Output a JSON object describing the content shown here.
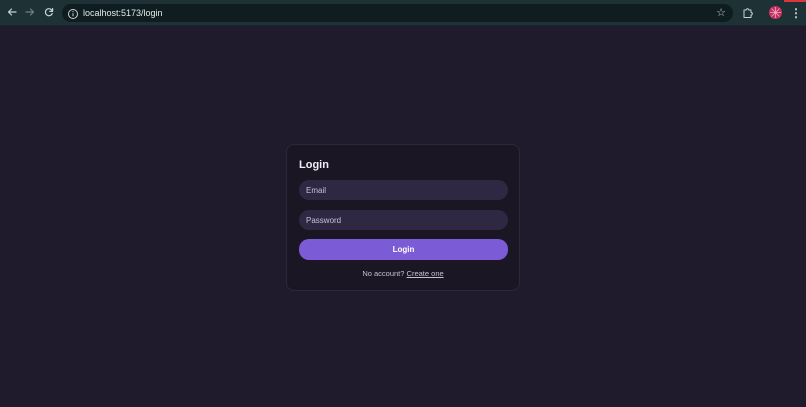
{
  "browser": {
    "url": "localhost:5173/login",
    "back_icon": "arrow-left-icon",
    "forward_icon": "arrow-right-icon",
    "reload_icon": "reload-icon",
    "bookmark_icon": "star-icon",
    "extensions_icon": "puzzle-icon",
    "menu_icon": "kebab-menu-icon"
  },
  "login": {
    "title": "Login",
    "email_placeholder": "Email",
    "password_placeholder": "Password",
    "submit_label": "Login",
    "no_account_text": "No account?",
    "create_link": "Create one"
  },
  "colors": {
    "page_background": "#1f1b2d",
    "card_background": "#1a1624",
    "input_background": "#2f2842",
    "accent": "#7b5cd6",
    "browser_bar": "#1e3135"
  }
}
